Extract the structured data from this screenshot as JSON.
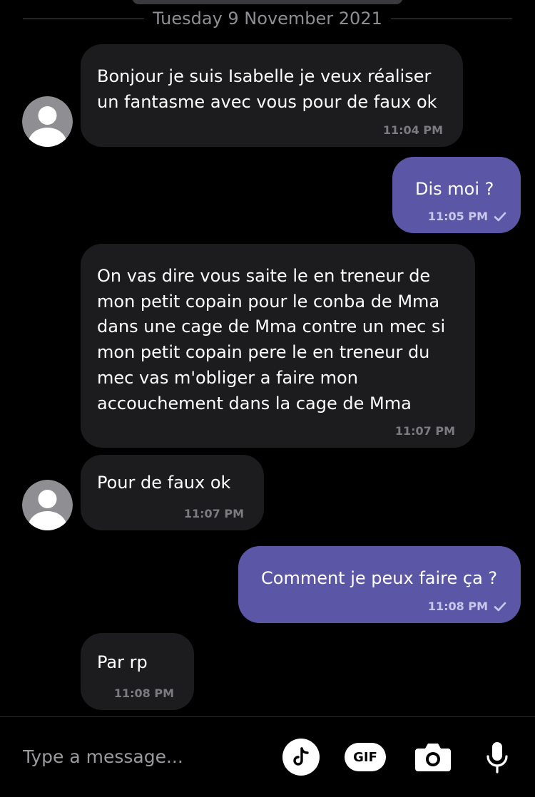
{
  "date_separator": "Tuesday 9 November 2021",
  "messages": [
    {
      "direction": "in",
      "lines": [
        "Bonjour je suis Isabelle je veux réaliser",
        "un fantasme avec vous pour de faux ok"
      ],
      "time": "11:04 PM"
    },
    {
      "direction": "out",
      "lines": [
        "Dis moi ?"
      ],
      "time": "11:05 PM"
    },
    {
      "direction": "in",
      "lines": [
        "On vas dire vous saite le en treneur de",
        "mon petit copain pour le conba de Mma",
        "dans une cage de Mma contre un mec si",
        "mon petit copain pere le en treneur du",
        "mec vas m'obliger a faire mon",
        "accouchement dans la cage de Mma"
      ],
      "time": "11:07 PM"
    },
    {
      "direction": "in",
      "lines": [
        "Pour de faux ok"
      ],
      "time": "11:07 PM"
    },
    {
      "direction": "out",
      "lines": [
        "Comment je peux faire ça ?"
      ],
      "time": "11:08 PM"
    },
    {
      "direction": "in",
      "lines": [
        "Par rp"
      ],
      "time": "11:08 PM"
    }
  ],
  "composer": {
    "placeholder": "Type a message...",
    "gif_label": "GIF"
  },
  "colors": {
    "background": "#000000",
    "incoming_bubble": "#1c1c1e",
    "outgoing_bubble": "#5b57a6"
  },
  "icons": [
    "avatar-placeholder-icon",
    "read-check-icon",
    "tiktok-icon",
    "gif-icon",
    "camera-icon",
    "microphone-icon"
  ]
}
